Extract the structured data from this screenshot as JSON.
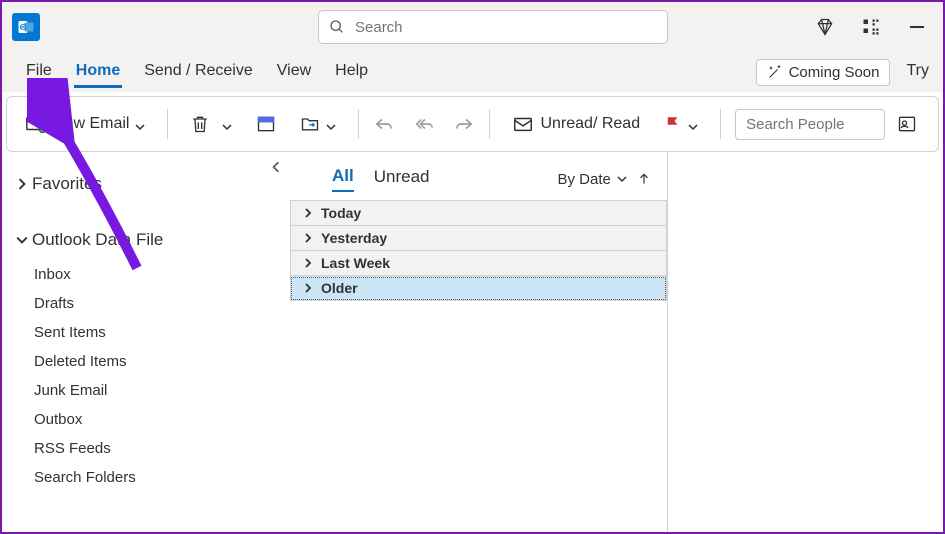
{
  "titlebar": {
    "search_placeholder": "Search"
  },
  "tabs": {
    "file": "File",
    "home": "Home",
    "send_receive": "Send / Receive",
    "view": "View",
    "help": "Help",
    "coming_soon": "Coming Soon",
    "try": "Try"
  },
  "toolbar": {
    "new_email": "New Email",
    "unread_read": "Unread/ Read",
    "search_people_placeholder": "Search People"
  },
  "nav": {
    "favorites": "Favorites",
    "data_file": "Outlook Data File",
    "folders": [
      "Inbox",
      "Drafts",
      "Sent Items",
      "Deleted Items",
      "Junk Email",
      "Outbox",
      "RSS Feeds",
      "Search Folders"
    ]
  },
  "list": {
    "all": "All",
    "unread": "Unread",
    "by_date": "By Date",
    "groups": [
      "Today",
      "Yesterday",
      "Last Week",
      "Older"
    ]
  }
}
